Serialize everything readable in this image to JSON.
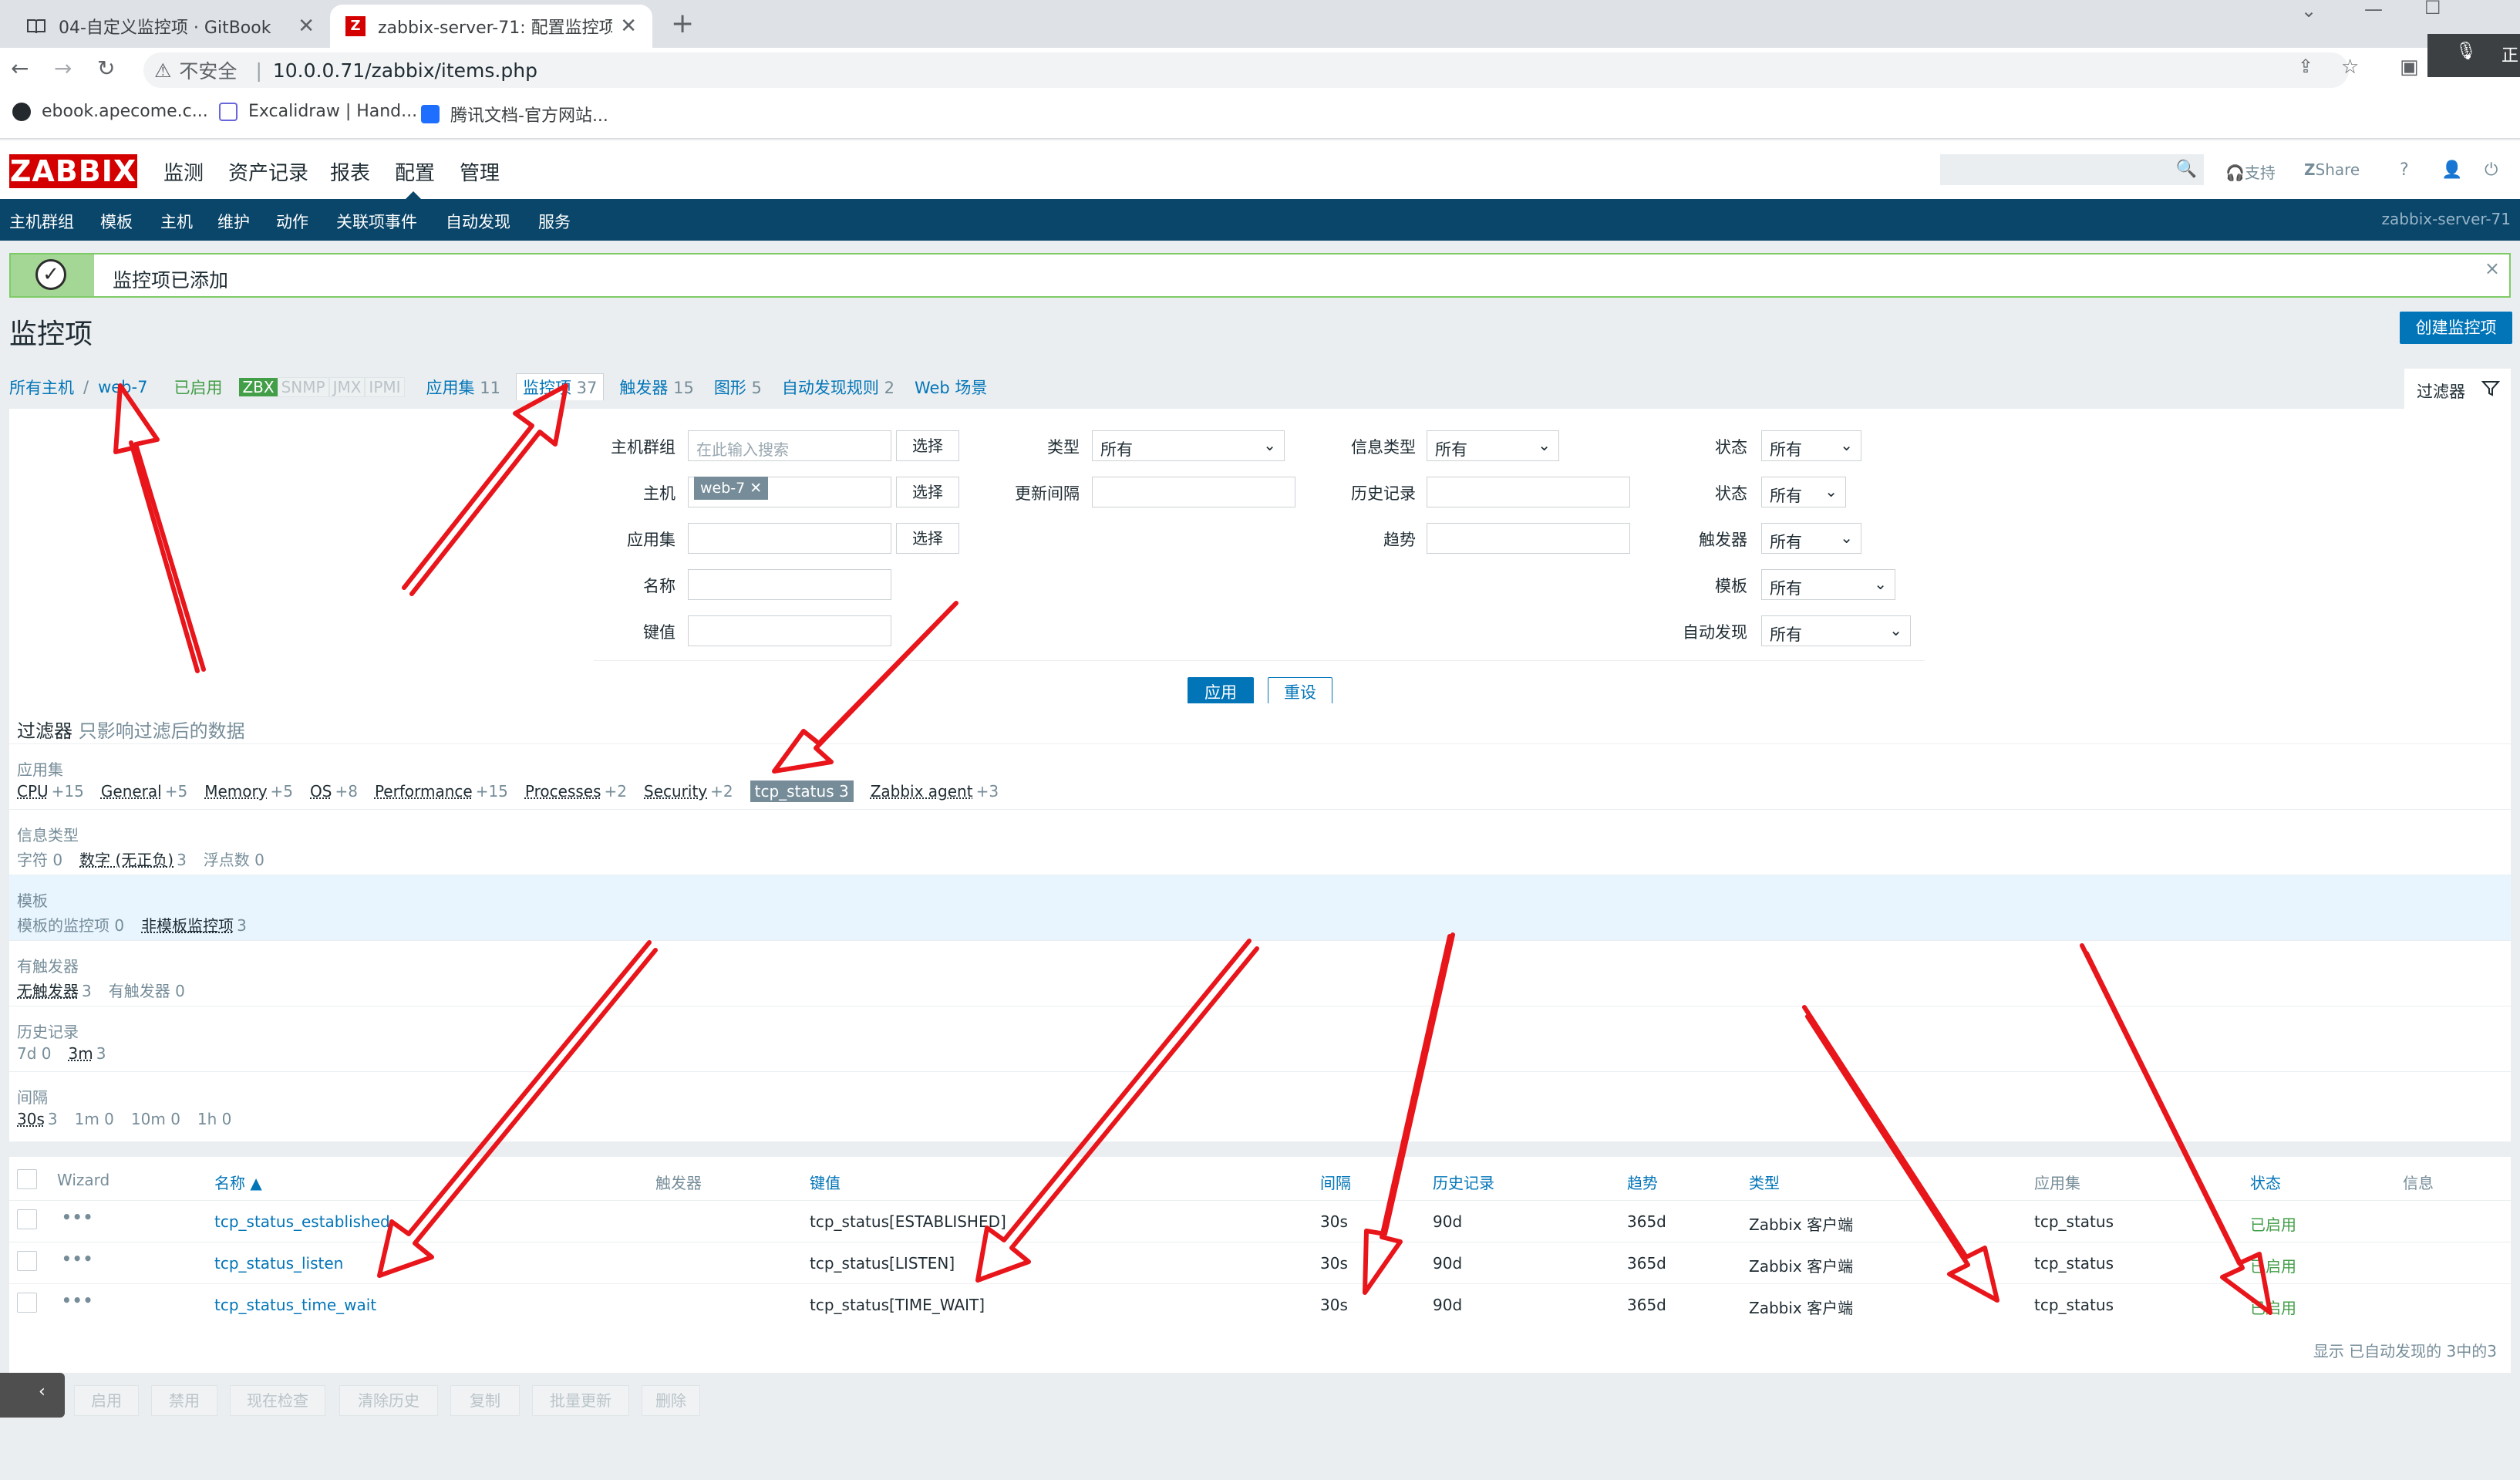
{
  "browser": {
    "tabs": [
      {
        "title": "04-自定义监控项 · GitBook",
        "close": "✕"
      },
      {
        "title": "zabbix-server-71: 配置监控项",
        "close": "✕"
      }
    ],
    "new_tab": "+",
    "address": {
      "security": "不安全",
      "url": "10.0.0.71/zabbix/items.php"
    },
    "bookmarks": [
      "ebook.apecome.c...",
      "Excalidraw | Hand...",
      "腾讯文档-官方网站..."
    ],
    "window_controls": [
      "⌄",
      "—",
      "☐"
    ],
    "edge_label": "正"
  },
  "zabbix": {
    "logo": "ZABBIX",
    "main_menu": [
      "监测",
      "资产记录",
      "报表",
      "配置",
      "管理"
    ],
    "header_links": {
      "support": "支持",
      "share": "Share",
      "help": "?"
    },
    "sub_menu": [
      "主机群组",
      "模板",
      "主机",
      "维护",
      "动作",
      "关联项事件",
      "自动发现",
      "服务"
    ],
    "server_name": "zabbix-server-71",
    "message": "监控项已添加",
    "page_title": "监控项",
    "create_button": "创建监控项",
    "breadcrumb": {
      "all_hosts": "所有主机",
      "sep": "/",
      "host": "web-7",
      "enabled": "已启用",
      "zbx": "ZBX",
      "snmp": "SNMP",
      "jmx": "JMX",
      "ipmi": "IPMI",
      "applications": "应用集",
      "applications_count": "11",
      "items": "监控项",
      "items_count": "37",
      "triggers": "触发器",
      "triggers_count": "15",
      "graphs": "图形",
      "graphs_count": "5",
      "discovery": "自动发现规则",
      "discovery_count": "2",
      "web": "Web 场景"
    },
    "filter_tab": "过滤器",
    "filter": {
      "host_groups_label": "主机群组",
      "host_groups_placeholder": "在此输入搜索",
      "select": "选择",
      "host_label": "主机",
      "host_tag": "web-7",
      "app_label": "应用集",
      "name_label": "名称",
      "key_label": "键值",
      "type_label": "类型",
      "type_value": "所有",
      "interval_label": "更新间隔",
      "info_type_label": "信息类型",
      "info_type_value": "所有",
      "history_label": "历史记录",
      "trends_label": "趋势",
      "state_label": "状态",
      "state_value": "所有",
      "status_label": "状态",
      "status_value": "所有",
      "triggers_label": "触发器",
      "triggers_value": "所有",
      "template_label": "模板",
      "template_value": "所有",
      "discovery_label": "自动发现",
      "discovery_value": "所有",
      "apply": "应用",
      "reset": "重设"
    },
    "subfilter": {
      "title": "过滤器",
      "hint": "只影响过滤后的数据",
      "groups": [
        {
          "title": "应用集",
          "values": [
            {
              "label": "CPU",
              "count": "+15"
            },
            {
              "label": "General",
              "count": "+5"
            },
            {
              "label": "Memory",
              "count": "+5"
            },
            {
              "label": "OS",
              "count": "+8"
            },
            {
              "label": "Performance",
              "count": "+15"
            },
            {
              "label": "Processes",
              "count": "+2"
            },
            {
              "label": "Security",
              "count": "+2"
            },
            {
              "label": "tcp_status",
              "count": "3",
              "selected": true
            },
            {
              "label": "Zabbix agent",
              "count": "+3"
            }
          ]
        },
        {
          "title": "信息类型",
          "values": [
            {
              "label": "字符",
              "count": "0",
              "disabled": true
            },
            {
              "label": "数字 (无正负)",
              "count": "3"
            },
            {
              "label": "浮点数",
              "count": "0",
              "disabled": true
            }
          ]
        },
        {
          "title": "模板",
          "highlight": true,
          "values": [
            {
              "label": "模板的监控项",
              "count": "0",
              "disabled": true
            },
            {
              "label": "非模板监控项",
              "count": "3"
            }
          ]
        },
        {
          "title": "有触发器",
          "values": [
            {
              "label": "无触发器",
              "count": "3"
            },
            {
              "label": "有触发器",
              "count": "0",
              "disabled": true
            }
          ]
        },
        {
          "title": "历史记录",
          "values": [
            {
              "label": "7d",
              "count": "0",
              "disabled": true
            },
            {
              "label": "3m",
              "count": "3"
            }
          ]
        },
        {
          "title": "间隔",
          "values": [
            {
              "label": "30s",
              "count": "3"
            },
            {
              "label": "1m",
              "count": "0",
              "disabled": true
            },
            {
              "label": "10m",
              "count": "0",
              "disabled": true
            },
            {
              "label": "1h",
              "count": "0",
              "disabled": true
            }
          ]
        }
      ]
    },
    "table": {
      "headers": {
        "wizard": "Wizard",
        "name": "名称 ▲",
        "triggers": "触发器",
        "key": "键值",
        "interval": "间隔",
        "history": "历史记录",
        "trends": "趋势",
        "type": "类型",
        "applications": "应用集",
        "status": "状态",
        "info": "信息"
      },
      "rows": [
        {
          "name": "tcp_status_established",
          "key": "tcp_status[ESTABLISHED]",
          "interval": "30s",
          "history": "90d",
          "trends": "365d",
          "type": "Zabbix 客户端",
          "application": "tcp_status",
          "status": "已启用"
        },
        {
          "name": "tcp_status_listen",
          "key": "tcp_status[LISTEN]",
          "interval": "30s",
          "history": "90d",
          "trends": "365d",
          "type": "Zabbix 客户端",
          "application": "tcp_status",
          "status": "已启用"
        },
        {
          "name": "tcp_status_time_wait",
          "key": "tcp_status[TIME_WAIT]",
          "interval": "30s",
          "history": "90d",
          "trends": "365d",
          "type": "Zabbix 客户端",
          "application": "tcp_status",
          "status": "已启用"
        }
      ],
      "footer": "显示 已自动发现的 3中的3"
    },
    "actions": [
      "启用",
      "禁用",
      "现在检查",
      "清除历史",
      "复制",
      "批量更新",
      "删除"
    ],
    "colors": {
      "brand": "#d40000",
      "nav": "#0a466a",
      "link": "#0275b8",
      "enabled": "#429e47",
      "annotation": "#e8151b"
    }
  }
}
